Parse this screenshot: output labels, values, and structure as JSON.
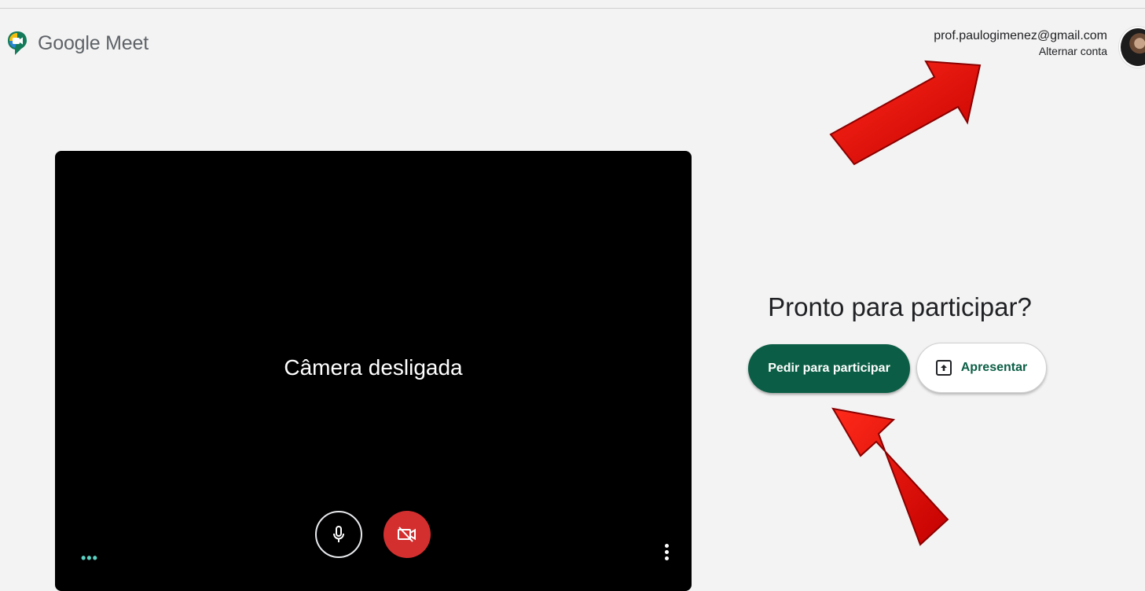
{
  "header": {
    "brand_google": "Google",
    "brand_meet": "Meet",
    "account_email": "prof.paulogimenez@gmail.com",
    "switch_account": "Alternar conta"
  },
  "preview": {
    "camera_status": "Câmera desligada",
    "more_options": "•••"
  },
  "join": {
    "title": "Pronto para participar?",
    "ask_to_join": "Pedir para participar",
    "present": "Apresentar"
  },
  "icons": {
    "logo": "google-meet-logo",
    "mic": "microphone-icon",
    "camera_off": "video-off-icon",
    "present": "present-upload-icon",
    "menu": "more-vertical-icon"
  },
  "colors": {
    "join_button": "#0b5e45",
    "camera_off_button": "#d32f2f",
    "annotation_arrow": "#e00000"
  }
}
